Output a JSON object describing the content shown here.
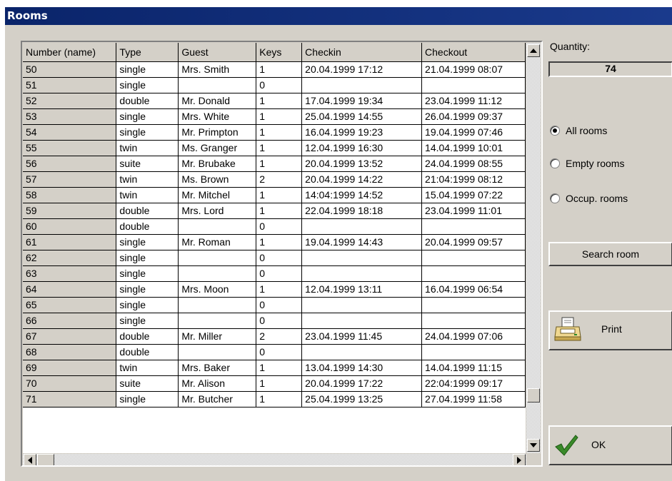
{
  "window": {
    "title": "Rooms"
  },
  "table": {
    "columns": [
      "Number (name)",
      "Type",
      "Guest",
      "Keys",
      "Checkin",
      "Checkout"
    ],
    "rows": [
      [
        "50",
        "single",
        "Mrs. Smith",
        "1",
        "20.04.1999  17:12",
        "21.04.1999  08:07"
      ],
      [
        "51",
        "single",
        "",
        "0",
        "",
        ""
      ],
      [
        "52",
        "double",
        "Mr. Donald",
        "1",
        "17.04.1999  19:34",
        "23.04.1999  11:12"
      ],
      [
        "53",
        "single",
        "Mrs. White",
        "1",
        "25.04.1999  14:55",
        "26.04.1999  09:37"
      ],
      [
        "54",
        "single",
        "Mr. Primpton",
        "1",
        "16.04.1999  19:23",
        "19.04.1999  07:46"
      ],
      [
        "55",
        "twin",
        "Ms. Granger",
        "1",
        "12.04.1999  16:30",
        "14.04.1999  10:01"
      ],
      [
        "56",
        "suite",
        "Mr. Brubake",
        "1",
        "20.04.1999  13:52",
        "24.04.1999  08:55"
      ],
      [
        "57",
        "twin",
        "Ms. Brown",
        "2",
        "20.04.1999  14:22",
        "21:04:1999  08:12"
      ],
      [
        "58",
        "twin",
        "Mr. Mitchel",
        "1",
        "14:04:1999  14:52",
        "15.04.1999  07:22"
      ],
      [
        "59",
        "double",
        "Mrs. Lord",
        "1",
        "22.04.1999  18:18",
        "23.04.1999  11:01"
      ],
      [
        "60",
        "double",
        "",
        "0",
        "",
        ""
      ],
      [
        "61",
        "single",
        "Mr. Roman",
        "1",
        "19.04.1999  14:43",
        "20.04.1999  09:57"
      ],
      [
        "62",
        "single",
        "",
        "0",
        "",
        ""
      ],
      [
        "63",
        "single",
        "",
        "0",
        "",
        ""
      ],
      [
        "64",
        "single",
        "Mrs. Moon",
        "1",
        "12.04.1999  13:11",
        "16.04.1999  06:54"
      ],
      [
        "65",
        "single",
        "",
        "0",
        "",
        ""
      ],
      [
        "66",
        "single",
        "",
        "0",
        "",
        ""
      ],
      [
        "67",
        "double",
        "Mr. Miller",
        "2",
        "23.04.1999  11:45",
        "24.04.1999  07:06"
      ],
      [
        "68",
        "double",
        "",
        "0",
        "",
        ""
      ],
      [
        "69",
        "twin",
        "Mrs. Baker",
        "1",
        "13.04.1999  14:30",
        "14.04.1999  11:15"
      ],
      [
        "70",
        "suite",
        "Mr. Alison",
        "1",
        "20.04.1999  17:22",
        "22:04:1999  09:17"
      ],
      [
        "71",
        "single",
        "Mr. Butcher",
        "1",
        "25.04.1999  13:25",
        "27.04.1999  11:58"
      ]
    ]
  },
  "quantity": {
    "label": "Quantity:",
    "value": "74"
  },
  "filter": {
    "options": [
      {
        "label": "All rooms",
        "selected": true
      },
      {
        "label": "Empty rooms",
        "selected": false
      },
      {
        "label": "Occup. rooms",
        "selected": false
      }
    ]
  },
  "buttons": {
    "search": "Search room",
    "print": "Print",
    "ok": "OK"
  },
  "icons": {
    "print": "printer-icon",
    "ok": "checkmark-icon"
  },
  "colors": {
    "titlebar": "#0a246a",
    "panel": "#d4d0c8",
    "ok_check": "#3a8a2a"
  }
}
